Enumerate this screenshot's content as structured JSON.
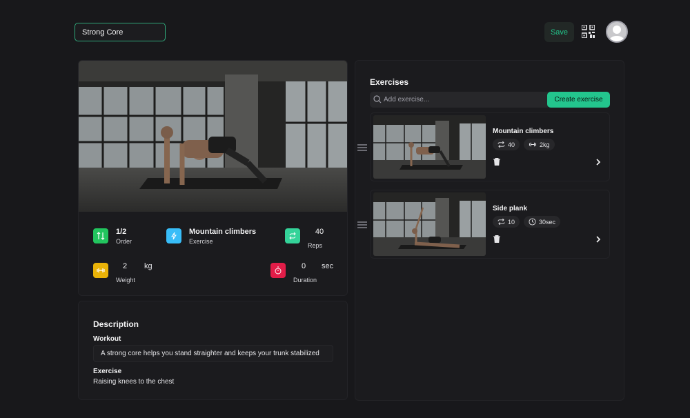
{
  "header": {
    "workout_name": "Strong Core",
    "save_label": "Save"
  },
  "stats": {
    "order": {
      "value": "1/2",
      "label": "Order"
    },
    "exercise": {
      "value": "Mountain climbers",
      "label": "Exercise"
    },
    "reps": {
      "value": "40",
      "label": "Reps"
    },
    "weight": {
      "value": "2",
      "unit": "kg",
      "label": "Weight"
    },
    "duration": {
      "value": "0",
      "unit": "sec",
      "label": "Duration"
    }
  },
  "description": {
    "title": "Description",
    "workout_label": "Workout",
    "workout_text": "A strong core helps you stand straighter and keeps your trunk stabilized",
    "exercise_label": "Exercise",
    "exercise_text": "Raising knees to the chest"
  },
  "exercises_panel": {
    "title": "Exercises",
    "search_placeholder": "Add exercise...",
    "create_label": "Create exercise",
    "items": [
      {
        "name": "Mountain climbers",
        "reps": "40",
        "extra": "2kg",
        "extra_icon": "dumbbell-icon"
      },
      {
        "name": "Side plank",
        "reps": "10",
        "extra": "30sec",
        "extra_icon": "timer-icon"
      }
    ]
  },
  "colors": {
    "accent": "#23c58d",
    "order_icon": "#22c55e",
    "exercise_icon": "#38bdf8",
    "reps_icon": "#34d399",
    "weight_icon": "#eab308",
    "duration_icon": "#e11d48"
  }
}
